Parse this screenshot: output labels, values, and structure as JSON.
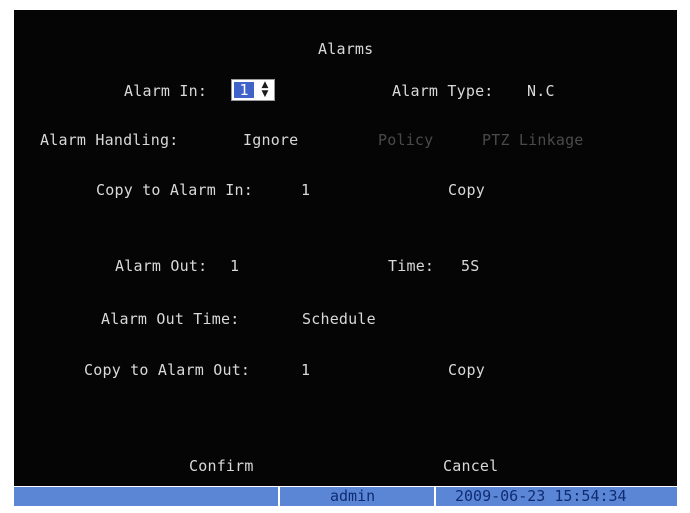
{
  "title": "Alarms",
  "alarm_in": {
    "label": "Alarm In:",
    "value": "1",
    "spinner_icon": "up-down-arrows"
  },
  "alarm_type": {
    "label": "Alarm Type:",
    "value": "N.C"
  },
  "alarm_handling": {
    "label": "Alarm Handling:",
    "value": "Ignore",
    "policy_label": "Policy",
    "ptz_label": "PTZ Linkage"
  },
  "copy_alarm_in": {
    "label": "Copy to Alarm In:",
    "value": "1",
    "button": "Copy"
  },
  "alarm_out": {
    "label": "Alarm Out:",
    "value": "1"
  },
  "time": {
    "label": "Time:",
    "value": "5S"
  },
  "alarm_out_time": {
    "label": "Alarm Out Time:",
    "value": "Schedule"
  },
  "copy_alarm_out": {
    "label": "Copy to Alarm Out:",
    "value": "1",
    "button": "Copy"
  },
  "buttons": {
    "confirm": "Confirm",
    "cancel": "Cancel"
  },
  "status": {
    "user": "admin",
    "datetime": "2009-06-23 15:54:34"
  },
  "colors": {
    "background": "#050505",
    "text": "#d9d9d9",
    "disabled": "#4a4a4a",
    "status_bar": "#5b86d6",
    "status_text": "#0f2c72",
    "selection": "#3f63c9"
  }
}
